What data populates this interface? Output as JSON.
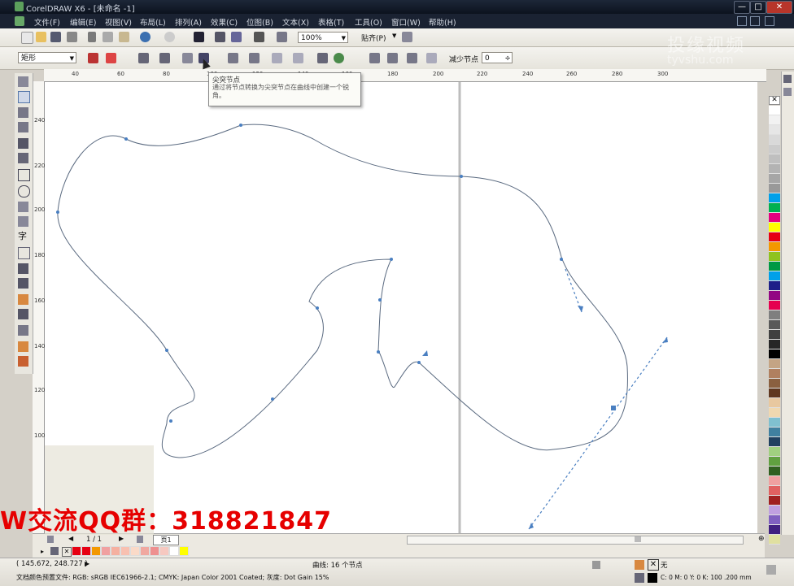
{
  "window": {
    "title": "CorelDRAW X6 - [未命名 -1]",
    "buttons": [
      "—",
      "□",
      "✕"
    ]
  },
  "menu": [
    "文件(F)",
    "编辑(E)",
    "视图(V)",
    "布局(L)",
    "排列(A)",
    "效果(C)",
    "位图(B)",
    "文本(X)",
    "表格(T)",
    "工具(O)",
    "窗口(W)",
    "帮助(H)"
  ],
  "standard_toolbar": {
    "zoom": "100%",
    "snap": "贴齐(P)"
  },
  "property_bar": {
    "shape_select": "矩形",
    "reduce_nodes_label": "减少节点",
    "reduce_nodes_value": "0"
  },
  "tooltip": {
    "title": "尖突节点",
    "description": "通过将节点转换为尖突节点在曲线中创建一个锐角。"
  },
  "rulers": {
    "top_labels": [
      "40",
      "60",
      "80",
      "100",
      "120",
      "140",
      "160",
      "180",
      "200",
      "220",
      "240",
      "260",
      "280",
      "300"
    ],
    "left_labels": [
      "240",
      "220",
      "200",
      "180",
      "160",
      "140",
      "120",
      "100"
    ]
  },
  "page_nav": {
    "page_count": "1 / 1",
    "page_tab": "页1"
  },
  "status": {
    "coords": "( 145.672, 248.727 )",
    "object_info": "曲线: 16 个节点",
    "color_profile": "文档颜色预置文件: RGB: sRGB IEC61966-2.1; CMYK: Japan Color 2001 Coated; 灰度: Dot Gain 15%",
    "fill_label": "无",
    "outline_info": "C: 0 M: 0 Y: 0 K: 100  .200 mm"
  },
  "watermark": {
    "main": "投缘视频",
    "url": "tyvshu.com"
  },
  "banner": {
    "text": "W交流QQ群：318821847"
  },
  "colors": {
    "accent": "#e60000",
    "curve": "#5a6a80",
    "node": "#4a7fc1"
  },
  "palette": [
    "#ffffff",
    "#f2f2f2",
    "#e6e6e6",
    "#d9d9d9",
    "#cccccc",
    "#bfbfbf",
    "#b3b3b3",
    "#a6a6a6",
    "#999999",
    "#00a0e9",
    "#00b050",
    "#e4007f",
    "#ffff00",
    "#e60012",
    "#f39800",
    "#8fc31f",
    "#009944",
    "#00a0e9",
    "#1d2088",
    "#920783",
    "#e5004f",
    "#7f7f7f",
    "#595959",
    "#404040",
    "#262626",
    "#000000",
    "#c4a484",
    "#b08060",
    "#8a6040",
    "#603820",
    "#e8c8a0",
    "#f0d8b0",
    "#80c0d0",
    "#4080a0",
    "#204060",
    "#a0d080",
    "#60a040",
    "#306020",
    "#f0a0a0",
    "#e06060",
    "#a02020",
    "#c0a0e0",
    "#8060c0",
    "#402080",
    "#e0e0a0"
  ]
}
